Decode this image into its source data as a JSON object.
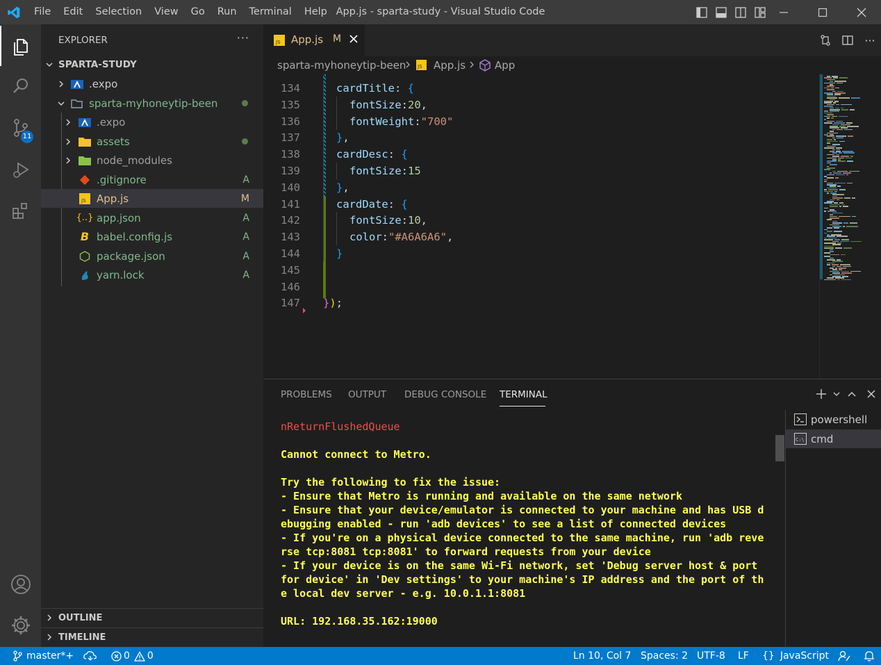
{
  "titlebar": {
    "menu": [
      "File",
      "Edit",
      "Selection",
      "View",
      "Go",
      "Run",
      "Terminal",
      "Help"
    ],
    "title": "App.js - sparta-study - Visual Studio Code"
  },
  "activity": {
    "scm_badge": "11"
  },
  "explorer": {
    "header": "EXPLORER",
    "more": "···",
    "root": "SPARTA-STUDY",
    "items": [
      {
        "label": ".expo",
        "status": ""
      },
      {
        "label": "sparta-myhoneytip-been",
        "status": ""
      },
      {
        "label": ".expo",
        "status": ""
      },
      {
        "label": "assets",
        "status": ""
      },
      {
        "label": "node_modules",
        "status": ""
      },
      {
        "label": ".gitignore",
        "status": "A"
      },
      {
        "label": "App.js",
        "status": "M"
      },
      {
        "label": "app.json",
        "status": "A"
      },
      {
        "label": "babel.config.js",
        "status": "A"
      },
      {
        "label": "package.json",
        "status": "A"
      },
      {
        "label": "yarn.lock",
        "status": "A"
      }
    ],
    "outline": "OUTLINE",
    "timeline": "TIMELINE"
  },
  "editor": {
    "tab": {
      "name": "App.js",
      "status": "M",
      "icon_text": "JS"
    },
    "breadcrumb": {
      "folder": "sparta-myhoneytip-been",
      "file": "App.js",
      "symbol": "App"
    },
    "lines": [
      {
        "num": "134",
        "indent": 1,
        "parts": [
          {
            "t": "cardTitle",
            "c": "c-prop"
          },
          {
            "t": ": ",
            "c": "c-punc"
          },
          {
            "t": "{",
            "c": "c-b3"
          }
        ]
      },
      {
        "num": "135",
        "indent": 2,
        "parts": [
          {
            "t": "fontSize",
            "c": "c-prop"
          },
          {
            "t": ":",
            "c": "c-punc"
          },
          {
            "t": "20",
            "c": "c-num"
          },
          {
            "t": ",",
            "c": "c-punc"
          }
        ]
      },
      {
        "num": "136",
        "indent": 2,
        "parts": [
          {
            "t": "fontWeight",
            "c": "c-prop"
          },
          {
            "t": ":",
            "c": "c-punc"
          },
          {
            "t": "\"700\"",
            "c": "c-str"
          }
        ]
      },
      {
        "num": "137",
        "indent": 1,
        "parts": [
          {
            "t": "}",
            "c": "c-b3"
          },
          {
            "t": ",",
            "c": "c-punc"
          }
        ]
      },
      {
        "num": "138",
        "indent": 1,
        "parts": [
          {
            "t": "cardDesc",
            "c": "c-prop"
          },
          {
            "t": ": ",
            "c": "c-punc"
          },
          {
            "t": "{",
            "c": "c-b3"
          }
        ]
      },
      {
        "num": "139",
        "indent": 2,
        "parts": [
          {
            "t": "fontSize",
            "c": "c-prop"
          },
          {
            "t": ":",
            "c": "c-punc"
          },
          {
            "t": "15",
            "c": "c-num"
          }
        ]
      },
      {
        "num": "140",
        "indent": 1,
        "parts": [
          {
            "t": "}",
            "c": "c-b3"
          },
          {
            "t": ",",
            "c": "c-punc"
          }
        ]
      },
      {
        "num": "141",
        "indent": 1,
        "parts": [
          {
            "t": "cardDate",
            "c": "c-prop"
          },
          {
            "t": ": ",
            "c": "c-punc"
          },
          {
            "t": "{",
            "c": "c-b3"
          }
        ]
      },
      {
        "num": "142",
        "indent": 2,
        "parts": [
          {
            "t": "fontSize",
            "c": "c-prop"
          },
          {
            "t": ":",
            "c": "c-punc"
          },
          {
            "t": "10",
            "c": "c-num"
          },
          {
            "t": ",",
            "c": "c-punc"
          }
        ]
      },
      {
        "num": "143",
        "indent": 2,
        "parts": [
          {
            "t": "color",
            "c": "c-prop"
          },
          {
            "t": ":",
            "c": "c-punc"
          },
          {
            "t": "\"#A6A6A6\"",
            "c": "c-str"
          },
          {
            "t": ",",
            "c": "c-punc"
          }
        ]
      },
      {
        "num": "144",
        "indent": 1,
        "parts": [
          {
            "t": "}",
            "c": "c-b3"
          }
        ]
      },
      {
        "num": "145",
        "indent": 0,
        "parts": []
      },
      {
        "num": "146",
        "indent": 0,
        "parts": []
      },
      {
        "num": "147",
        "indent": 0,
        "parts": [
          {
            "t": "}",
            "c": "c-b2"
          },
          {
            "t": ")",
            "c": "c-b1"
          },
          {
            "t": ";",
            "c": "c-punc"
          }
        ]
      }
    ]
  },
  "panel": {
    "tabs": [
      "PROBLEMS",
      "OUTPUT",
      "DEBUG CONSOLE",
      "TERMINAL"
    ],
    "terminal_lines": [
      {
        "text": "nReturnFlushedQueue",
        "red": true
      },
      {
        "text": "",
        "red": false
      },
      {
        "text": "Cannot connect to Metro.",
        "red": false
      },
      {
        "text": "",
        "red": false
      },
      {
        "text": "Try the following to fix the issue:",
        "red": false
      },
      {
        "text": "- Ensure that Metro is running and available on the same network",
        "red": false
      },
      {
        "text": "- Ensure that your device/emulator is connected to your machine and has USB d",
        "red": false
      },
      {
        "text": "ebugging enabled - run 'adb devices' to see a list of connected devices",
        "red": false
      },
      {
        "text": "- If you're on a physical device connected to the same machine, run 'adb reve",
        "red": false
      },
      {
        "text": "rse tcp:8081 tcp:8081' to forward requests from your device",
        "red": false
      },
      {
        "text": "- If your device is on the same Wi-Fi network, set 'Debug server host & port",
        "red": false
      },
      {
        "text": "for device' in 'Dev settings' to your machine's IP address and the port of th",
        "red": false
      },
      {
        "text": "e local dev server - e.g. 10.0.1.1:8081",
        "red": false
      },
      {
        "text": "",
        "red": false
      },
      {
        "text": "URL: 192.168.35.162:19000",
        "red": false
      }
    ],
    "terminals": [
      {
        "label": "powershell",
        "icon_text": ">_"
      },
      {
        "label": "cmd",
        "icon_text": "C:\\"
      }
    ]
  },
  "statusbar": {
    "branch": "master*+",
    "errors": "0",
    "warnings": "0",
    "position": "Ln 10, Col 7",
    "spaces": "Spaces: 2",
    "encoding": "UTF-8",
    "eol": "LF",
    "language": "JavaScript"
  }
}
